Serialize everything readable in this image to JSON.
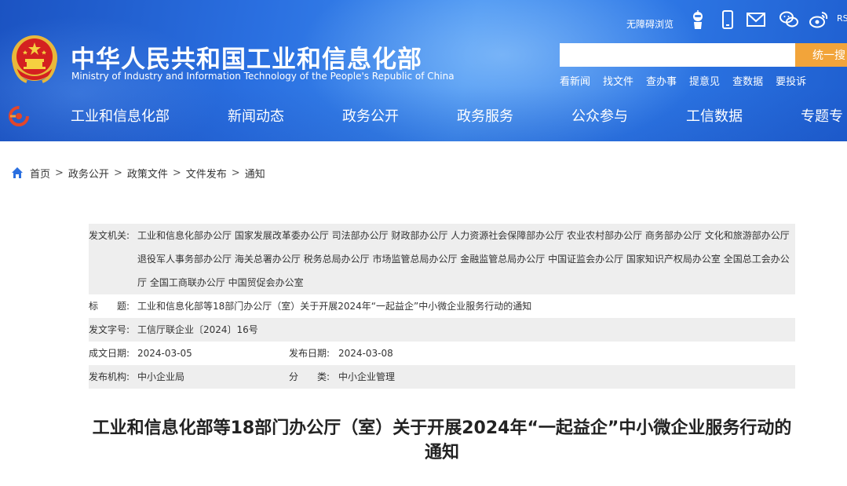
{
  "header": {
    "title": "中华人民共和国工业和信息化部",
    "subtitle": "Ministry of Industry and Information Technology of the People's Republic of China",
    "utility": {
      "accessibility": "无障碍浏览",
      "rss": "RS"
    },
    "search": {
      "placeholder": "",
      "button_label": "统一搜"
    },
    "quick_links": [
      "看新闻",
      "找文件",
      "查办事",
      "提意见",
      "查数据",
      "要投诉"
    ],
    "nav": [
      "工业和信息化部",
      "新闻动态",
      "政务公开",
      "政务服务",
      "公众参与",
      "工信数据",
      "专题专"
    ]
  },
  "breadcrumb": [
    "首页",
    "政务公开",
    "政策文件",
    "文件发布",
    "通知"
  ],
  "meta": {
    "issuer_label": "发文机关:",
    "issuer_value": "工业和信息化部办公厅 国家发展改革委办公厅 司法部办公厅 财政部办公厅 人力资源社会保障部办公厅 农业农村部办公厅 商务部办公厅 文化和旅游部办公厅 退役军人事务部办公厅 海关总署办公厅 税务总局办公厅 市场监管总局办公厅 金融监管总局办公厅 中国证监会办公厅 国家知识产权局办公室 全国总工会办公厅 全国工商联办公厅 中国贸促会办公室",
    "title_label": "标　　题:",
    "title_value": "工业和信息化部等18部门办公厅（室）关于开展2024年“一起益企”中小微企业服务行动的通知",
    "docno_label": "发文字号:",
    "docno_value": "工信厅联企业〔2024〕16号",
    "created_label": "成文日期:",
    "created_value": "2024-03-05",
    "published_label": "发布日期:",
    "published_value": "2024-03-08",
    "org_label": "发布机构:",
    "org_value": "中小企业局",
    "category_label": "分　　类:",
    "category_value": "中小企业管理"
  },
  "article": {
    "title": "工业和信息化部等18部门办公厅（室）关于开展2024年“一起益企”中小微企业服务行动的通知"
  },
  "colors": {
    "header_blue": "#2a6fe0",
    "search_button": "#f2a43a",
    "meta_shade": "#eeeeee",
    "home_icon": "#2a6fe0"
  }
}
